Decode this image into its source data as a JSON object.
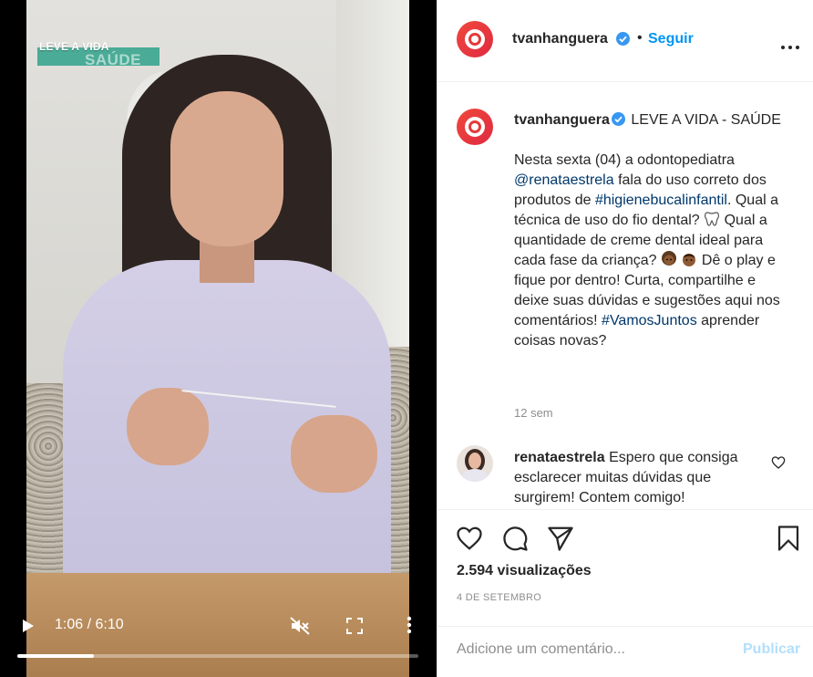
{
  "video": {
    "show_title_line1": "LEVE A VIDA",
    "show_title_line2": "SAÚDE",
    "time": "1:06 / 6:10",
    "progress": 0.19,
    "icons": [
      "play-icon",
      "muted-speaker-icon",
      "fullscreen-icon",
      "more-vertical-icon"
    ]
  },
  "header": {
    "username": "tvanhanguera",
    "separator": "•",
    "follow_label": "Seguir",
    "icons": [
      "verified-badge-icon",
      "more-horizontal-icon"
    ]
  },
  "caption": {
    "username": "tvanhanguera",
    "title": "LEVE A VIDA - SAÚDE",
    "t1": "Nesta sexta (04) a odontopediatra ",
    "mention": "@renataestrela",
    "t2": " fala do uso correto dos produtos de ",
    "hashtag1": "#higienebucalinfantil",
    "t3": ". Qual a técnica de uso do fio dental? ",
    "t4": " Qual a quantidade de creme dental ideal para cada fase da criança? ",
    "t5": " Dê o play e fique por dentro! Curta, compartilhe e deixe suas dúvidas e sugestões aqui nos comentários!",
    "hashtag2": "#VamosJuntos",
    "t6": " aprender coisas novas?",
    "emojis": [
      "tooth-emoji",
      "girl-emoji",
      "boy-emoji"
    ],
    "time_ago": "12 sem"
  },
  "comment": {
    "username": "renataestrela",
    "text": "Espero que consiga esclarecer muitas dúvidas que surgirem! Contem comigo!"
  },
  "actions": {
    "views": "2.594 visualizações",
    "date": "4 DE SETEMBRO",
    "icons": [
      "heart-icon",
      "comment-icon",
      "share-icon",
      "bookmark-icon"
    ]
  },
  "compose": {
    "placeholder": "Adicione um comentário...",
    "publish_label": "Publicar"
  },
  "colors": {
    "link_blue": "#0095f6",
    "hashtag_blue": "#00376b",
    "publish_disabled": "#b2dffc",
    "brand_red": "#e53a3a",
    "badge_green": "#3aa58e"
  }
}
